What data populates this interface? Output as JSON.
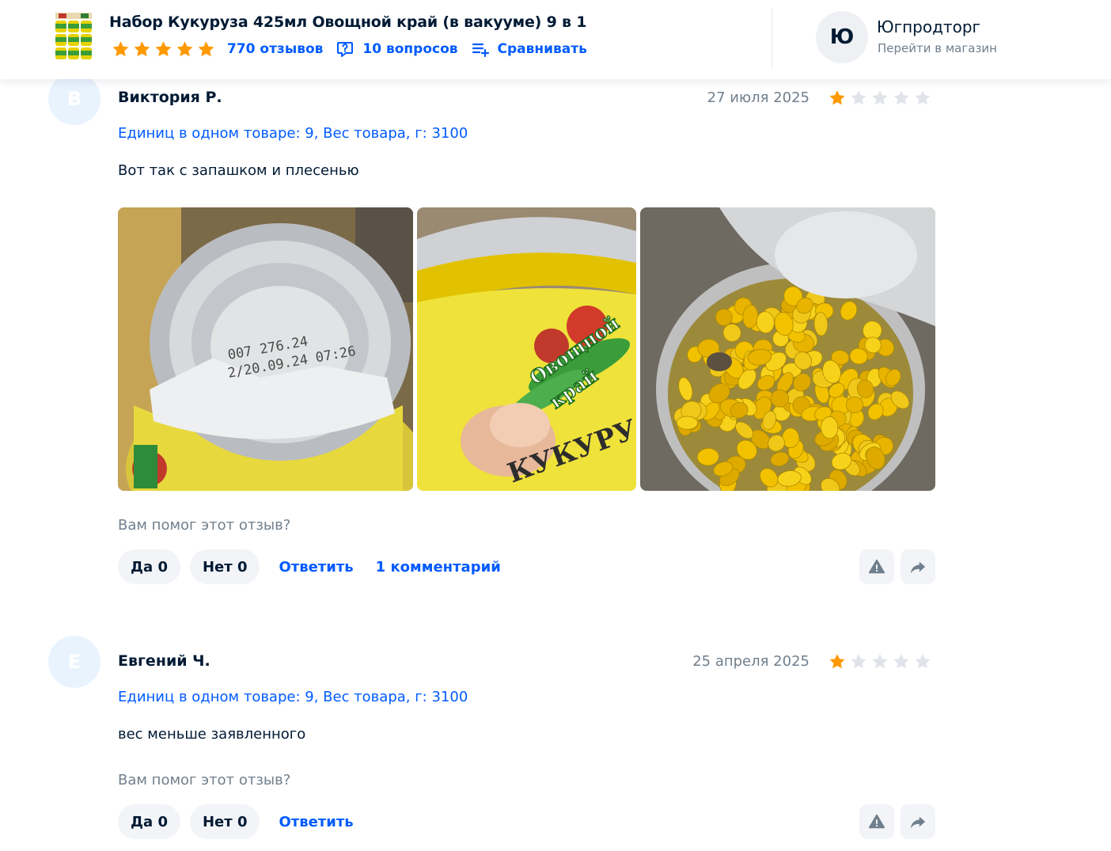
{
  "header": {
    "product_title": "Набор Кукуруза 425мл Овощной край (в вакууме) 9 в 1",
    "rating_stars": 5,
    "reviews_link": "770 отзывов",
    "questions_link": "10 вопросов",
    "compare_link": "Сравнивать",
    "shop_initial": "Ю",
    "shop_name": "Югпродторг",
    "shop_link": "Перейти в магазин",
    "star_color": "#ff9900"
  },
  "reviews": [
    {
      "avatar_letter": "В",
      "author": "Виктория Р.",
      "date": "27 июля 2025",
      "rating": 1,
      "variant": "Единиц в одном товаре: 9, Вес товара, г: 3100",
      "text": "Вот так с запашком и плесенью",
      "photos": [
        "can-lid-photo",
        "can-label-photo",
        "corn-kernels-photo"
      ],
      "helpful_question": "Вам помог этот отзыв?",
      "yes_label": "Да 0",
      "no_label": "Нет 0",
      "reply_label": "Ответить",
      "comments_label": "1 комментарий"
    },
    {
      "avatar_letter": "Е",
      "author": "Евгений Ч.",
      "date": "25 апреля 2025",
      "rating": 1,
      "variant": "Единиц в одном товаре: 9, Вес товара, г: 3100",
      "text": "вес меньше заявленного",
      "helpful_question": "Вам помог этот отзыв?",
      "yes_label": "Да 0",
      "no_label": "Нет 0",
      "reply_label": "Ответить"
    }
  ],
  "photo_overlay": {
    "can_print_line1": "007 276.24",
    "can_print_line2": "2/20.09.24 07:26",
    "brand_line1": "Овощной",
    "brand_line2": "край",
    "label_word": "КУКУРУ"
  }
}
